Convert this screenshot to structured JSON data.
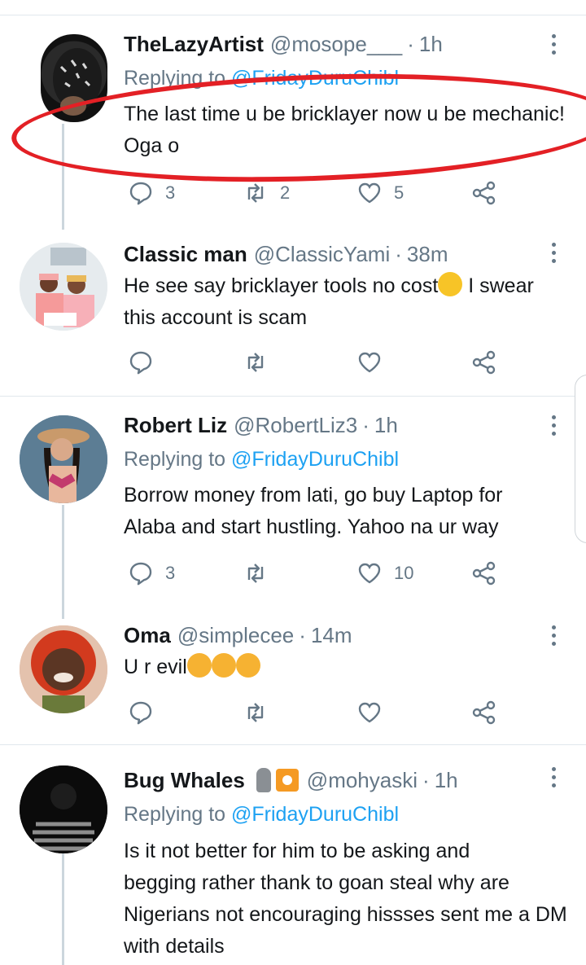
{
  "tweets": [
    {
      "name": "TheLazyArtist",
      "handle": "@mosope___",
      "time": "1h",
      "replying_prefix": "Replying to ",
      "replying_to": "@FridayDuruChibl",
      "lines": [
        "The last time u be bricklayer now u be mechanic!",
        "Oga o"
      ],
      "replies": "3",
      "retweets": "2",
      "likes": "5"
    },
    {
      "name": "Classic man",
      "handle": "@ClassicYami",
      "time": "38m",
      "line1_before": "He see say bricklayer tools  no cost",
      "line1_after": " I swear",
      "line2": "this account is scam",
      "emoji": "face-with-tears-of-joy",
      "replies": "",
      "retweets": "",
      "likes": ""
    },
    {
      "name": "Robert Liz",
      "handle": "@RobertLiz3",
      "time": "1h",
      "replying_prefix": "Replying to ",
      "replying_to": "@FridayDuruChibl",
      "lines": [
        "Borrow money from lati, go buy Laptop for",
        "Alaba and start hustling. Yahoo na ur way"
      ],
      "replies": "3",
      "retweets": "",
      "likes": "10"
    },
    {
      "name": "Oma",
      "handle": "@simplecee",
      "time": "14m",
      "text": "U r evil",
      "emoji": "cat-with-tears-of-joy",
      "replies": "",
      "retweets": "",
      "likes": ""
    },
    {
      "name": "Bug Whales",
      "handle": "@mohyaski",
      "time": "1h",
      "badges": [
        "moai-icon",
        "record-button-icon"
      ],
      "replying_prefix": "Replying to ",
      "replying_to": "@FridayDuruChibl",
      "lines": [
        "Is it not better for him to be asking and",
        "begging rather thank to goan steal why are",
        "Nigerians not encouraging hissses sent me a DM",
        "with details"
      ]
    }
  ],
  "separator": "·",
  "colors": {
    "accent": "#1da1f2",
    "secondary_text": "#657786",
    "annotation_circle": "#e32025"
  }
}
